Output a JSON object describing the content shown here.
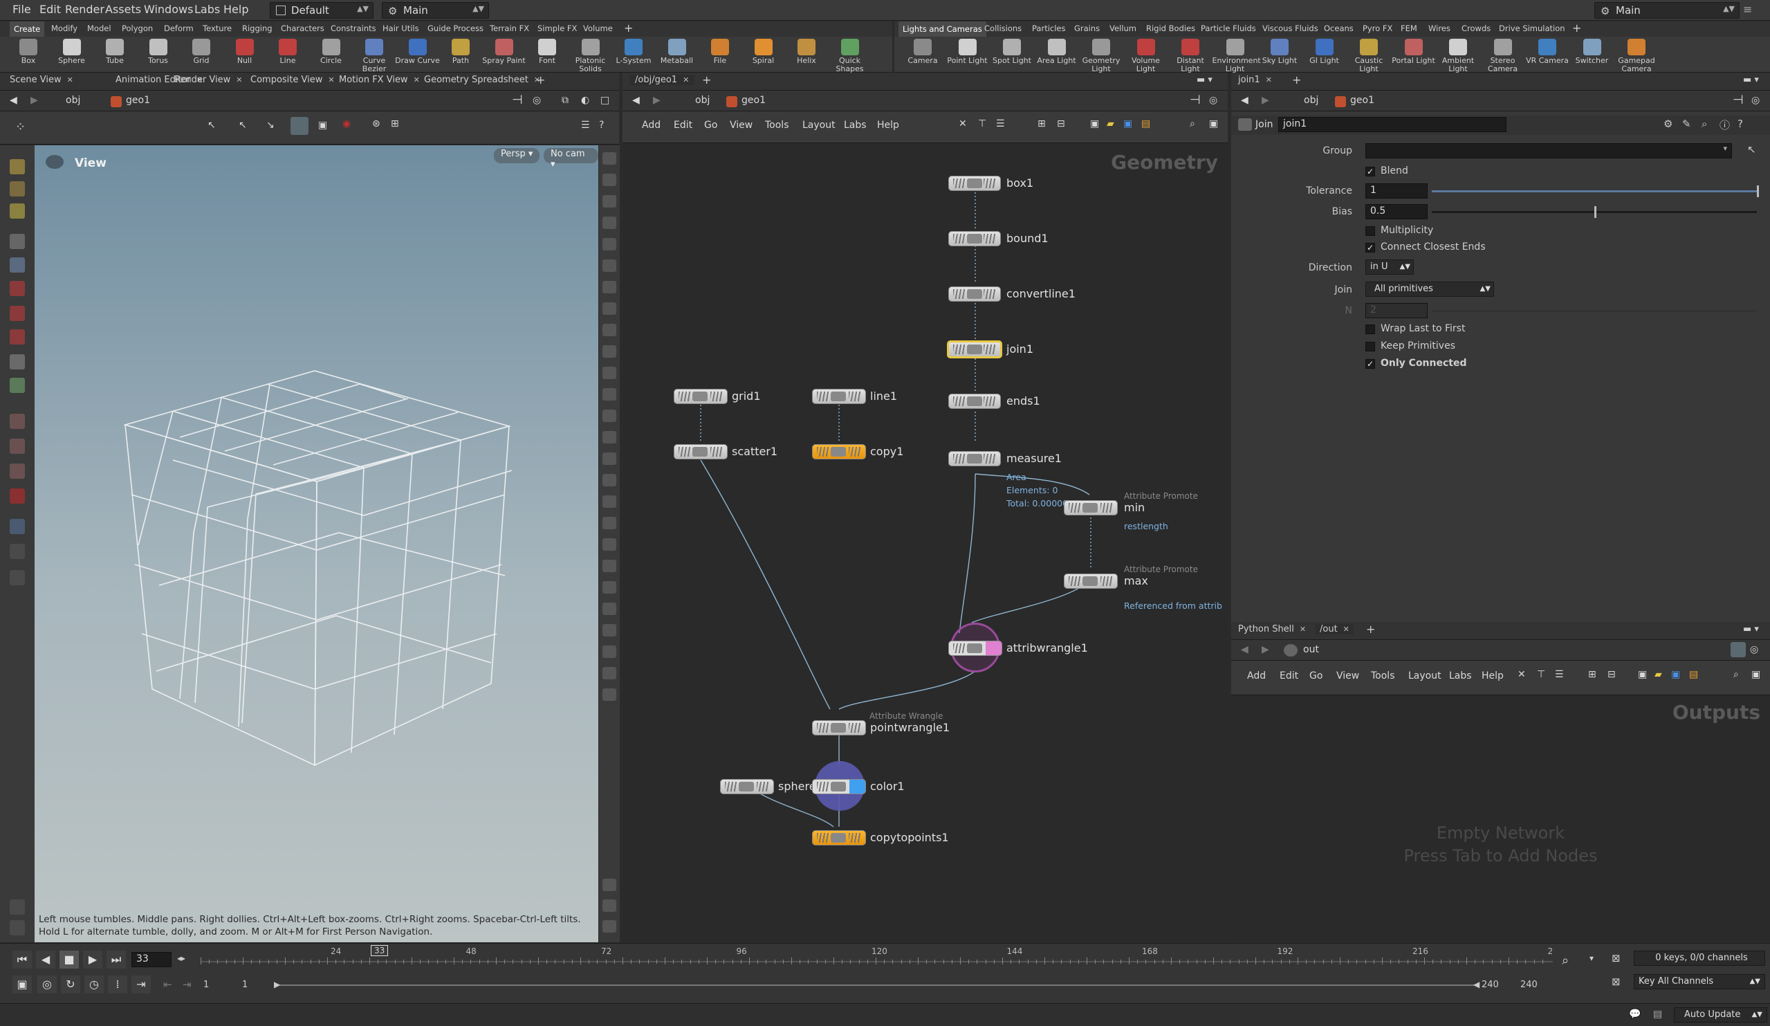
{
  "menu": [
    "File",
    "Edit",
    "Render",
    "Assets",
    "Windows",
    "Labs",
    "Help"
  ],
  "desktop": "Default",
  "context": "Main",
  "right_context": "Main",
  "shelf_tabs_left": [
    "Create",
    "Modify",
    "Model",
    "Polygon",
    "Deform",
    "Texture",
    "Rigging",
    "Characters",
    "Constraints",
    "Hair Utils",
    "Guide Process",
    "Terrain FX",
    "Simple FX",
    "Volume"
  ],
  "shelf_tabs_right": [
    "Lights and Cameras",
    "Collisions",
    "Particles",
    "Grains",
    "Vellum",
    "Rigid Bodies",
    "Particle Fluids",
    "Viscous Fluids",
    "Oceans",
    "Pyro FX",
    "FEM",
    "Wires",
    "Crowds",
    "Drive Simulation"
  ],
  "tools_left": [
    "Box",
    "Sphere",
    "Tube",
    "Torus",
    "Grid",
    "Null",
    "Line",
    "Circle",
    "Curve Bezier",
    "Draw Curve",
    "Path",
    "Spray Paint",
    "Font",
    "Platonic Solids",
    "L-System",
    "Metaball",
    "File",
    "Spiral",
    "Helix",
    "Quick Shapes"
  ],
  "tools_right": [
    "Camera",
    "Point Light",
    "Spot Light",
    "Area Light",
    "Geometry Light",
    "Volume Light",
    "Distant Light",
    "Environment Light",
    "Sky Light",
    "GI Light",
    "Caustic Light",
    "Portal Light",
    "Ambient Light",
    "Stereo Camera",
    "VR Camera",
    "Switcher",
    "Gamepad Camera"
  ],
  "left_tabs": [
    "Scene View",
    "Animation Editor",
    "Render View",
    "Composite View",
    "Motion FX View",
    "Geometry Spreadsheet"
  ],
  "left_path": {
    "root": "obj",
    "node": "geo1"
  },
  "viewport": {
    "title": "View",
    "persp": "Persp",
    "cam": "No cam",
    "hint": "Left mouse tumbles. Middle pans. Right dollies. Ctrl+Alt+Left box-zooms. Ctrl+Right zooms. Spacebar-Ctrl-Left tilts. Hold L for alternate tumble, dolly, and zoom. M or Alt+M for First Person Navigation."
  },
  "net_tab": "/obj/geo1",
  "net_path": {
    "root": "obj",
    "node": "geo1"
  },
  "net_menu": [
    "Add",
    "Edit",
    "Go",
    "View",
    "Tools",
    "Layout",
    "Labs",
    "Help"
  ],
  "net_context": "Geometry",
  "nodes": {
    "box1": "box1",
    "bound1": "bound1",
    "convertline1": "convertline1",
    "join1": "join1",
    "ends1": "ends1",
    "measure1": "measure1",
    "grid1": "grid1",
    "scatter1": "scatter1",
    "line1": "line1",
    "copy1": "copy1",
    "min": "min",
    "min_type": "Attribute Promote",
    "min_info": "restlength",
    "max": "max",
    "max_type": "Attribute Promote",
    "max_info": "Referenced from attrib",
    "attribwrangle1": "attribwrangle1",
    "pointwrangle1": "pointwrangle1",
    "pointwrangle1_type": "Attribute Wrangle",
    "sphere": "sphere",
    "color1": "color1",
    "copytopoints1": "copytopoints1",
    "measure_info1": "Area",
    "measure_info2": "Elements: 0",
    "measure_info3": "Total: 0.00000"
  },
  "params": {
    "tab": "join1",
    "path_root": "obj",
    "path_node": "geo1",
    "type": "Join",
    "name": "join1",
    "group_label": "Group",
    "blend_label": "Blend",
    "blend": true,
    "tolerance_label": "Tolerance",
    "tolerance": "1",
    "tolerance_frac": 1.0,
    "bias_label": "Bias",
    "bias": "0.5",
    "bias_frac": 0.5,
    "multiplicity_label": "Multiplicity",
    "multiplicity": false,
    "connect_label": "Connect Closest Ends",
    "connect": true,
    "direction_label": "Direction",
    "direction": "in U",
    "join_label": "Join",
    "join": "All primitives",
    "n_label": "N",
    "n": "2",
    "wrap_label": "Wrap Last to First",
    "wrap": false,
    "keep_label": "Keep Primitives",
    "keep": false,
    "only_label": "Only Connected",
    "only": true
  },
  "bottom_tabs": [
    "Python Shell",
    "/out"
  ],
  "out_path": "out",
  "out_menu": [
    "Add",
    "Edit",
    "Go",
    "View",
    "Tools",
    "Layout",
    "Labs",
    "Help"
  ],
  "out_context": "Outputs",
  "empty1": "Empty Network",
  "empty2": "Press Tab to Add Nodes",
  "timeline": {
    "frame": "33",
    "ticks": [
      "24",
      "48",
      "72",
      "96",
      "120",
      "144",
      "168",
      "192",
      "216",
      "2"
    ],
    "marker": "33",
    "start": "1",
    "start2": "1",
    "end": "240",
    "end2": "240",
    "keys": "0 keys, 0/0 channels",
    "key_all": "Key All Channels",
    "auto": "Auto Update"
  },
  "colors": {
    "accent": "#f0a020",
    "selected": "#e8c840",
    "info": "#7fb3e0"
  }
}
